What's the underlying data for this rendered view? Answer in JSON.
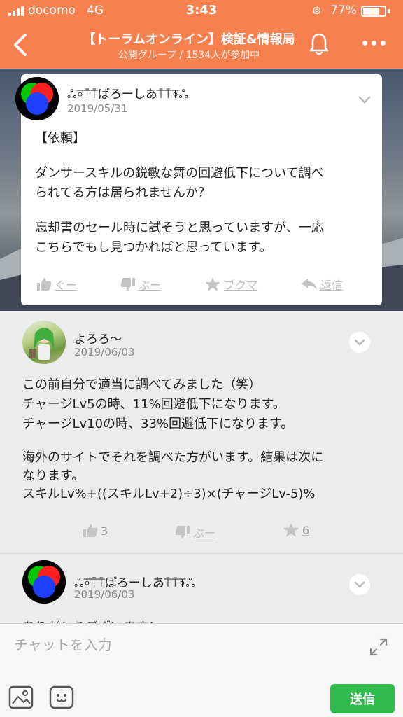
{
  "status_bar": {
    "carrier": "docomo",
    "network": "4G",
    "time": "3:43",
    "battery": "77%",
    "battery_level": 0.77
  },
  "header": {
    "title": "【トーラムオンライン】検証&情報局",
    "subtitle": "公開グループ / 1534人が参加中"
  },
  "post": {
    "author": "ஃ⍕⍑⍑ぱろーしあ⍑⍑⍕ஃ",
    "date": "2019/05/31",
    "lines": [
      "【依頼】",
      "ダンサースキルの鋭敏な舞の回避低下について調べ",
      "られてる方は居られませんか？",
      "忘却書のセール時に試そうと思っていますが、一応",
      "こちらでもし見つかればと思っています。"
    ],
    "actions": {
      "like": "ぐー",
      "dislike": "ぶー",
      "bookmark": "ブクマ",
      "reply": "返信"
    }
  },
  "comments": [
    {
      "author": "よろろ〜",
      "date": "2019/06/03",
      "lines": [
        "この前自分で適当に調べてみました（笑）",
        "チャージLv5の時、11%回避低下になります。",
        "チャージLv10の時、33%回避低下になります。",
        "海外のサイトでそれを調べた方がいます。結果は次に",
        "なります。",
        "スキルLv%+((スキルLv+2)÷3)×(チャージLv-5)%"
      ],
      "likes": "3",
      "dislike": "ぶー",
      "stars": "6"
    },
    {
      "author": "ஃ⍕⍑⍑ぱろーしあ⍑⍑⍕ஃ",
      "date": "2019/06/03",
      "preview": "ありがとうございます！"
    }
  ],
  "input": {
    "placeholder": "チャットを入力",
    "send": "送信"
  },
  "colors": {
    "header": "#f6814f",
    "send": "#2fb94a",
    "background": "#ececec"
  }
}
